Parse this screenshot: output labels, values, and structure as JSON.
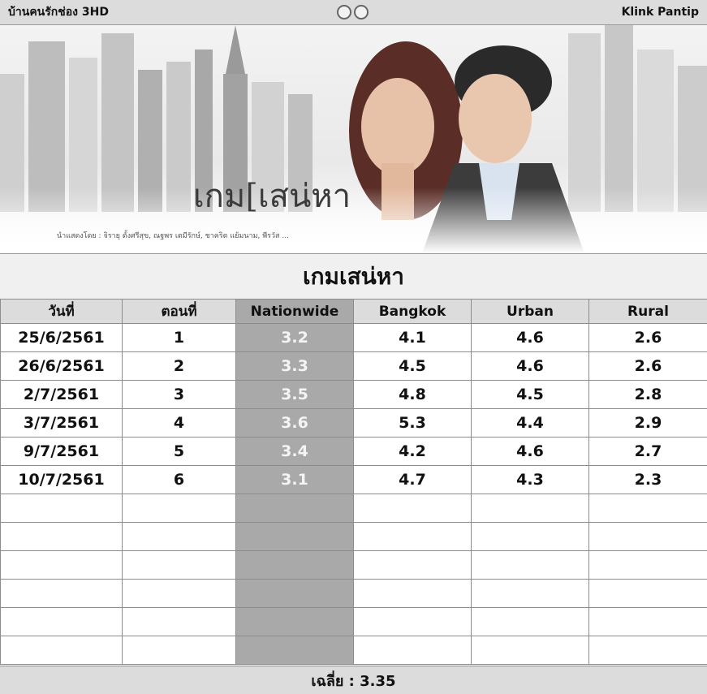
{
  "header": {
    "left_text": "บ้านคนรักช่อง 3HD",
    "right_text": "Klink Pantip",
    "logo_icon": "channel3-logo-icon"
  },
  "banner": {
    "title": "เกม[เสน่หา",
    "cast": "นำแสดงโดย : จิรายุ ตั้งศรีสุข, ณฐพร เตมีรักษ์, ชาคริต แย้มนาม, พีรวัส ..."
  },
  "table": {
    "title": "เกมเสน่หา",
    "columns": [
      "วันที่",
      "ตอนที่",
      "Nationwide",
      "Bangkok",
      "Urban",
      "Rural"
    ],
    "rows": [
      [
        "25/6/2561",
        "1",
        "3.2",
        "4.1",
        "4.6",
        "2.6"
      ],
      [
        "26/6/2561",
        "2",
        "3.3",
        "4.5",
        "4.6",
        "2.6"
      ],
      [
        "2/7/2561",
        "3",
        "3.5",
        "4.8",
        "4.5",
        "2.8"
      ],
      [
        "3/7/2561",
        "4",
        "3.6",
        "5.3",
        "4.4",
        "2.9"
      ],
      [
        "9/7/2561",
        "5",
        "3.4",
        "4.2",
        "4.6",
        "2.7"
      ],
      [
        "10/7/2561",
        "6",
        "3.1",
        "4.7",
        "4.3",
        "2.3"
      ]
    ],
    "empty_rows": 6
  },
  "footer": {
    "average_text": "เฉลี่ย : 3.35"
  },
  "colors": {
    "header_bg": "#dcdcdc",
    "nationwide_bg": "#a9a9a9",
    "nationwide_text": "#f4f4f4"
  }
}
